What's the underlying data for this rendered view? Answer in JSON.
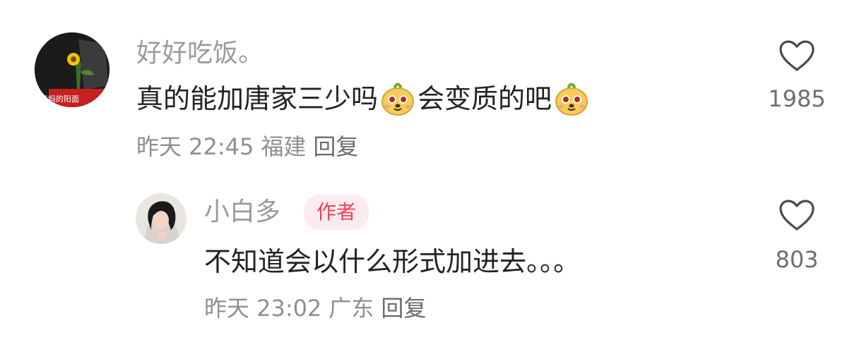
{
  "comments": [
    {
      "username": "好好吃饭。",
      "avatar_caption": "妈妈的阳面",
      "text_parts": [
        "真的能加唐家三少吗",
        "会变质的吧"
      ],
      "emoji_icon": "cute-face-emoji",
      "time": "昨天 22:45",
      "location": "福建",
      "reply_label": "回复",
      "like_count": "1985",
      "like_icon": "heart-outline-icon"
    },
    {
      "username": "小白多",
      "badge": "作者",
      "text": "不知道会以什么形式加进去。。。",
      "time": "昨天 23:02",
      "location": "广东",
      "reply_label": "回复",
      "like_count": "803",
      "like_icon": "heart-outline-icon"
    }
  ],
  "colors": {
    "username": "#9a9a9a",
    "badge_text": "#f0405a",
    "badge_bg": "#fdecef",
    "body_text": "#222222",
    "meta_text": "#8f8f8f"
  }
}
